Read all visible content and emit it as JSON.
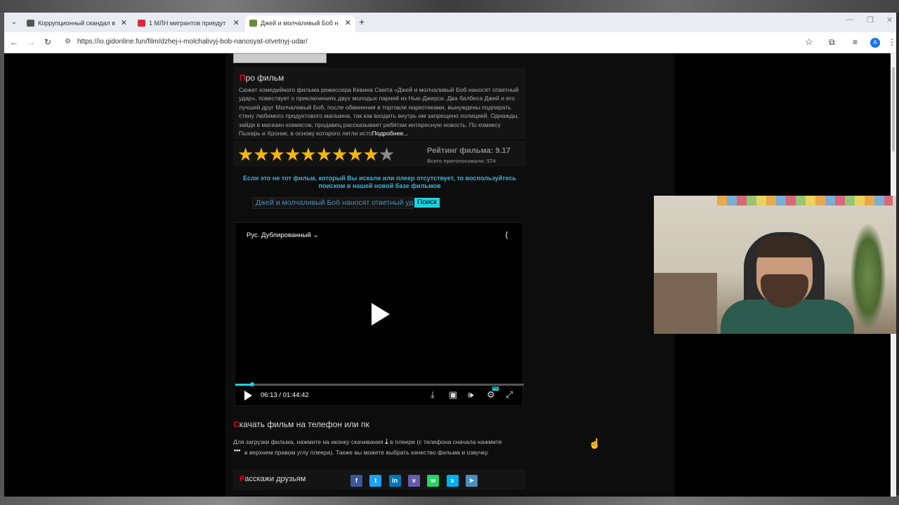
{
  "browser": {
    "tabs": [
      {
        "title": "Коррупционный скандал в см",
        "favicon_color": "#555555",
        "active": false
      },
      {
        "title": "1 МЛН мигрантов приедут в",
        "favicon_color": "#e0243a",
        "active": false
      },
      {
        "title": "Джей и молчаливый Боб нанос",
        "favicon_color": "#6a8c3a",
        "active": true
      }
    ],
    "url": "https://io.gidonline.fun/film/dzhej-i-molchalivyj-bob-nanosyat-otvetnyj-udar/",
    "profile_initial": "A"
  },
  "page": {
    "about": {
      "heading_first": "П",
      "heading_rest": "ро фильм",
      "description": "Сюжет комедийного фильма режиссера Кевина Смита «Джей и молчаливый Боб наносят ответный удар», повествует о приключениях двух молодых парней из Нью-Джерси. Два балбеса Джей и его лучший друг Молчаливый Боб, после обвинения в торговле наркотиками, вынуждены подпирать стену любимого продуктового магазина, так как входить внутрь им запрещено полицией. Однажды, зайдя в магазин комиксов, продавец рассказывает ребятам интересную новость. По комиксу Пыхарь и Хроник, в основу которого легли исто",
      "more_label": "Подробнее..."
    },
    "rating": {
      "label": "Рейтинг фильма: 9.17",
      "votes": "Всего проголосовали: 574",
      "value": 9.17,
      "max": 10
    },
    "notice": "Если это не тот фильм, который Вы искали или плеер отсутствует, то воспользуйтесь поиском в нашей новой базе фильмов",
    "search": {
      "value": "Джей и молчаливый Боб наносят ответный удар",
      "button": "Поиск"
    },
    "player": {
      "dub_label": "Рус. Дублированный",
      "time": "06:13 / 01:44:42",
      "progress": 0.059,
      "quality_badge": "HD"
    },
    "download": {
      "heading_first": "С",
      "heading_rest": "качать фильм на телефон или пк",
      "text_before": "Для загрузки фильма, нажмите на иконку скачивания",
      "text_after": "в плеере (с телефона сначала нажмите",
      "text_line2": "в верхнем правом углу плеера). Также вы можете выбрать качество фильма и озвучку."
    },
    "share": {
      "heading_first": "Р",
      "heading_rest": "асскажи друзьям",
      "networks": [
        {
          "name": "facebook-icon",
          "glyph": "f",
          "color": "#3b5998"
        },
        {
          "name": "twitter-icon",
          "glyph": "t",
          "color": "#1da1f2"
        },
        {
          "name": "linkedin-icon",
          "glyph": "in",
          "color": "#0077b5"
        },
        {
          "name": "viber-icon",
          "glyph": "v",
          "color": "#665cac"
        },
        {
          "name": "whatsapp-icon",
          "glyph": "w",
          "color": "#25d366"
        },
        {
          "name": "skype-icon",
          "glyph": "s",
          "color": "#00aff0"
        },
        {
          "name": "telegram-icon",
          "glyph": "➤",
          "color": "#4a8fc0"
        }
      ]
    }
  }
}
